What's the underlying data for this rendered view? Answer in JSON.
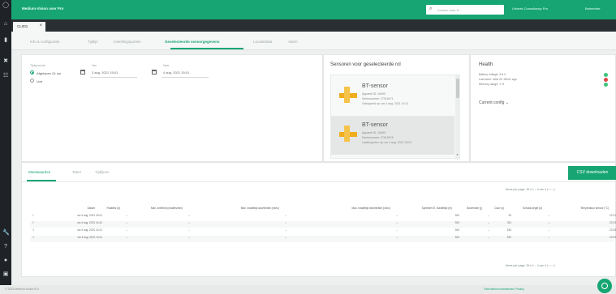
{
  "app": {
    "title": "Medium-Vision user Pro"
  },
  "header": {
    "search_placeholder": "Zoeken naar R...",
    "organization": "Unimek Consultancy Pro",
    "user": "Beheerder"
  },
  "doc_tab": {
    "label": "CL001"
  },
  "subnav": {
    "items": [
      "Info & configuratie",
      "Tijdlijn",
      "Instellingspunten",
      "Geselecteerde sensorgegevens",
      "Locatiedata",
      "Alarm"
    ],
    "active": "Geselecteerde sensorgegevens"
  },
  "filter": {
    "period_label": "Tijdsperiode",
    "option_custom": "Afgelopen 24 uur",
    "option_live": "Live",
    "from_label": "Van",
    "from_value": "3 aug. 2021 15:01",
    "to_label": "Naar",
    "to_value": "4 aug. 2021 15:01"
  },
  "sensors": {
    "title": "Sensoren voor geselecteerde rol",
    "items": [
      {
        "name": "BT-sensor",
        "appId": "Appareil ID: 18490",
        "serial": "Serienummer: 27019471",
        "seen": "Gekoppeld op: wo 4 aug. 2021 14:11"
      },
      {
        "name": "BT-sensor",
        "appId": "Appareil ID: 15460",
        "serial": "Serienummer: 27019478",
        "seen": "Laatst gezien op: wo 4 aug. 2021 15:01"
      }
    ]
  },
  "health": {
    "title": "Health",
    "battery": "Battery voltage: 3.6 V",
    "last_seen": "Last seen: Wed 04 15h41 ago",
    "memory": "Memory usage: 1 %",
    "config": "Current config"
  },
  "data": {
    "tabs": [
      "Meetwaarden",
      "Tabel",
      "Tijdlijnen"
    ],
    "active_tab": "Meetwaarden",
    "csv_button": "CSV downloaden",
    "pager_top": "Items per page:  25   ▾   1 – 4 van 4    |‹   ‹   ›   ›|",
    "pager_bottom": "Items per page:  25   ▾   1 – 4 van 4    |‹   ‹   ›   ›|",
    "columns": [
      "Datum",
      "Rotaties (#)",
      "Max. snelheid (rotaties/min)",
      "Max. rotatietijd acceleratie (rot/s²)",
      "Max. rotatietijd deceleratie (rot/s²)",
      "Spreiden El. buildettijd (m)",
      "Bolvenster (j)",
      "Door (s)",
      "Schokk-kegel (#)",
      "Temperatuur sensor (°C)"
    ],
    "rows": [
      [
        "wo 4 aug. 2021 15:01",
        "–",
        "–",
        "–",
        "–",
        "300",
        "–",
        "33",
        "–",
        "22.01"
      ],
      [
        "wo 4 aug. 2021 14:41",
        "–",
        "–",
        "–",
        "–",
        "300",
        "–",
        "311",
        "–",
        "22.03"
      ],
      [
        "wo 4 aug. 2021 14:21",
        "–",
        "–",
        "–",
        "–",
        "300",
        "–",
        "330",
        "–",
        "22.05"
      ],
      [
        "wo 4 aug. 2021 14:11",
        "–",
        "–",
        "–",
        "–",
        "300",
        "–",
        "342",
        "–",
        "22.06"
      ]
    ]
  },
  "footer": {
    "left": "© 2023 Medium-Vision B.V.",
    "right": "Gebruikersvoorwaarden   Privacy"
  },
  "colors": {
    "primary": "#17a673",
    "rail": "#1f2328",
    "ok": "#3cc47c",
    "alert": "#e04848"
  }
}
